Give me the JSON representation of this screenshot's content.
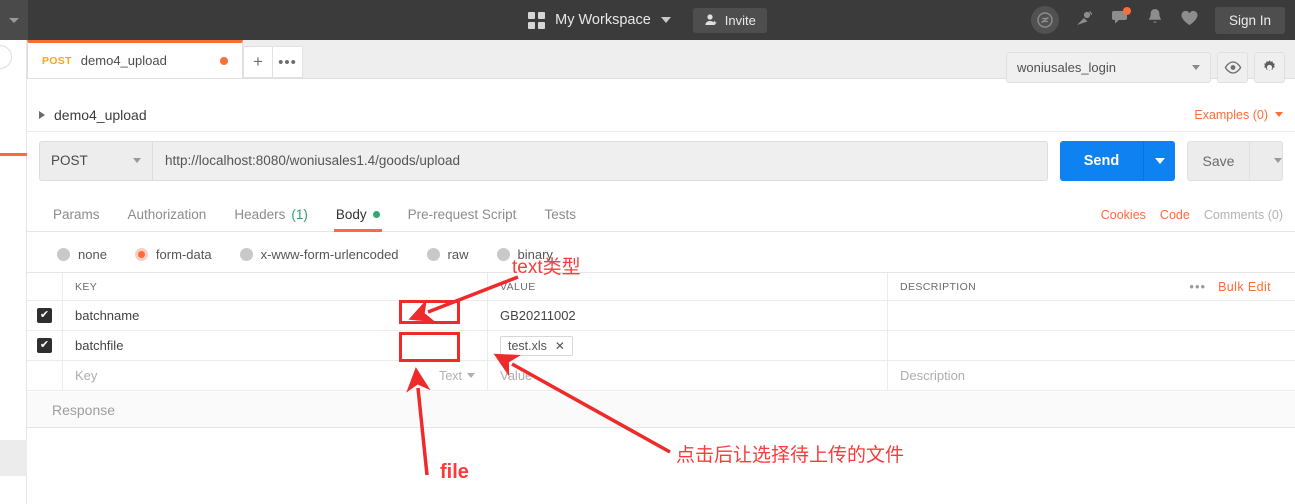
{
  "header": {
    "workspace": "My Workspace",
    "invite_label": "Invite",
    "signin_label": "Sign In",
    "icons": [
      "grid-icon",
      "chevron-down-icon",
      "user-add-icon",
      "sync-off-icon",
      "satellite-icon",
      "comment-icon",
      "bell-icon",
      "heart-icon"
    ]
  },
  "tabstrip": {
    "tab": {
      "method": "POST",
      "name": "demo4_upload",
      "unsaved_dot": true
    },
    "new_tab_label": "+",
    "more_label": "•••"
  },
  "environment": {
    "selected": "woniusales_login",
    "eye_icon": "eye-icon",
    "gear_icon": "gear-icon"
  },
  "breadcrumb": {
    "name": "demo4_upload",
    "examples_label": "Examples (0)"
  },
  "request": {
    "method": "POST",
    "url": "http://localhost:8080/woniusales1.4/goods/upload",
    "send_label": "Send",
    "save_label": "Save"
  },
  "section_tabs": [
    {
      "label": "Params",
      "active": false
    },
    {
      "label": "Authorization",
      "active": false
    },
    {
      "label": "Headers",
      "count": "(1)",
      "active": false
    },
    {
      "label": "Body",
      "active": true
    },
    {
      "label": "Pre-request Script",
      "active": false
    },
    {
      "label": "Tests",
      "active": false
    }
  ],
  "right_links": {
    "cookies": "Cookies",
    "code": "Code",
    "comments": "Comments (0)"
  },
  "body_types": [
    {
      "label": "none",
      "selected": false
    },
    {
      "label": "form-data",
      "selected": true
    },
    {
      "label": "x-www-form-urlencoded",
      "selected": false
    },
    {
      "label": "raw",
      "selected": false
    },
    {
      "label": "binary",
      "selected": false
    }
  ],
  "kv_table": {
    "headers": {
      "key": "KEY",
      "value": "VALUE",
      "description": "DESCRIPTION"
    },
    "more_label": "•••",
    "bulk_edit_label": "Bulk Edit",
    "rows": [
      {
        "checked": true,
        "key": "batchname",
        "value": "GB20211002",
        "description": "",
        "type": "text"
      },
      {
        "checked": true,
        "key": "batchfile",
        "value": "test.xls",
        "description": "",
        "type": "file",
        "chip_close": "✕"
      }
    ],
    "placeholder_row": {
      "key": "Key",
      "type": "Text",
      "value": "Value",
      "description": "Description"
    }
  },
  "response": {
    "title": "Response"
  },
  "annotations": [
    {
      "id": "text-type",
      "text": "text类型"
    },
    {
      "id": "file-type",
      "text": "file"
    },
    {
      "id": "click-to-select-file",
      "text": "点击后让选择待上传的文件"
    }
  ],
  "colors": {
    "accent_orange": "#ff6c37",
    "send_blue": "#0d82f0",
    "annotation_red": "#fb3b3b",
    "topbar": "#3b3b3b",
    "green": "#2fab6b"
  }
}
